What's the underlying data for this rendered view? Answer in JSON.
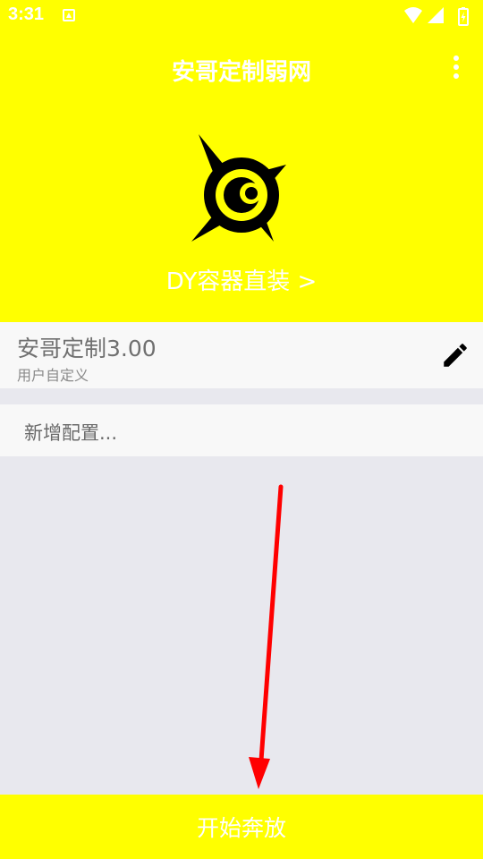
{
  "status_bar": {
    "time": "3:31",
    "icons": [
      "notification-a-icon",
      "wifi-icon",
      "signal-icon",
      "battery-charging-icon"
    ]
  },
  "header": {
    "title": "安哥定制弱网",
    "menu_icon": "more-vert-icon",
    "logo_icon": "compass-eye-logo",
    "container_link": "DY容器直装 >"
  },
  "config": {
    "name": "安哥定制3.00",
    "description": "用户自定义",
    "edit_icon": "pencil-icon"
  },
  "add_config": {
    "label": "新增配置..."
  },
  "annotation": {
    "icon": "red-arrow-down",
    "color": "#ff0000"
  },
  "bottom_bar": {
    "label": "开始奔放"
  },
  "colors": {
    "accent": "#ffff00",
    "text_on_accent": "#ffffff",
    "background": "#e8e8ee"
  }
}
